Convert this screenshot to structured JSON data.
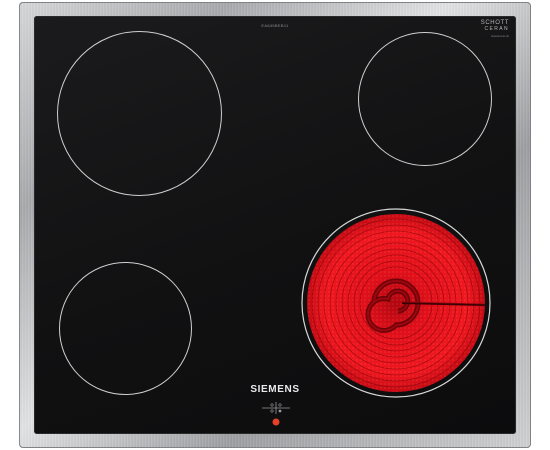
{
  "product": {
    "model_number": "EA645BEB11",
    "glass_brand_line1": "SCHOTT",
    "glass_brand_line2": "CERAN",
    "glass_brand_line3": "Glasskeramik",
    "brand": "SIEMENS"
  },
  "zones": [
    {
      "name": "rear-left",
      "state": "off"
    },
    {
      "name": "rear-right",
      "state": "off"
    },
    {
      "name": "front-left",
      "state": "off"
    },
    {
      "name": "front-right",
      "state": "on",
      "glow_color": "#e8141c"
    }
  ],
  "indicator": {
    "state": "on",
    "color": "#e54028"
  },
  "colors": {
    "glass": "#111112",
    "zone_outline": "#cfcfd1",
    "frame": "#b4b6b9",
    "heat": "#e8141c"
  }
}
